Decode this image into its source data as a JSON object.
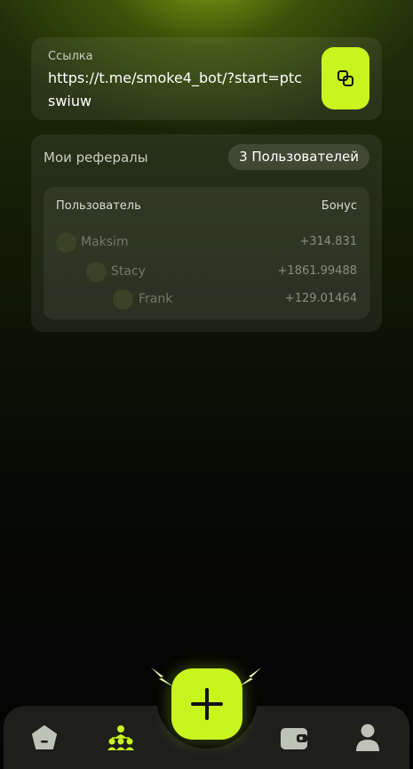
{
  "link": {
    "label": "Ссылка",
    "url": "https://t.me/smoke4_bot/?start=ptcswiuw"
  },
  "referrals": {
    "title": "Мои рефералы",
    "count_badge": "3 Пользователей",
    "table": {
      "headers": {
        "user": "Пользователь",
        "bonus": "Бонус"
      },
      "rows": [
        {
          "name": "Maksim",
          "bonus": "+314.831"
        },
        {
          "name": "Stacy",
          "bonus": "+1861.99488"
        },
        {
          "name": "Frank",
          "bonus": "+129.01464"
        }
      ]
    }
  },
  "nav": {
    "items": [
      "home-icon",
      "referrals-icon",
      "add-icon",
      "wallet-icon",
      "profile-icon"
    ]
  },
  "colors": {
    "accent": "#c8f51e",
    "background": "#050704",
    "card": "#1c1f16"
  }
}
